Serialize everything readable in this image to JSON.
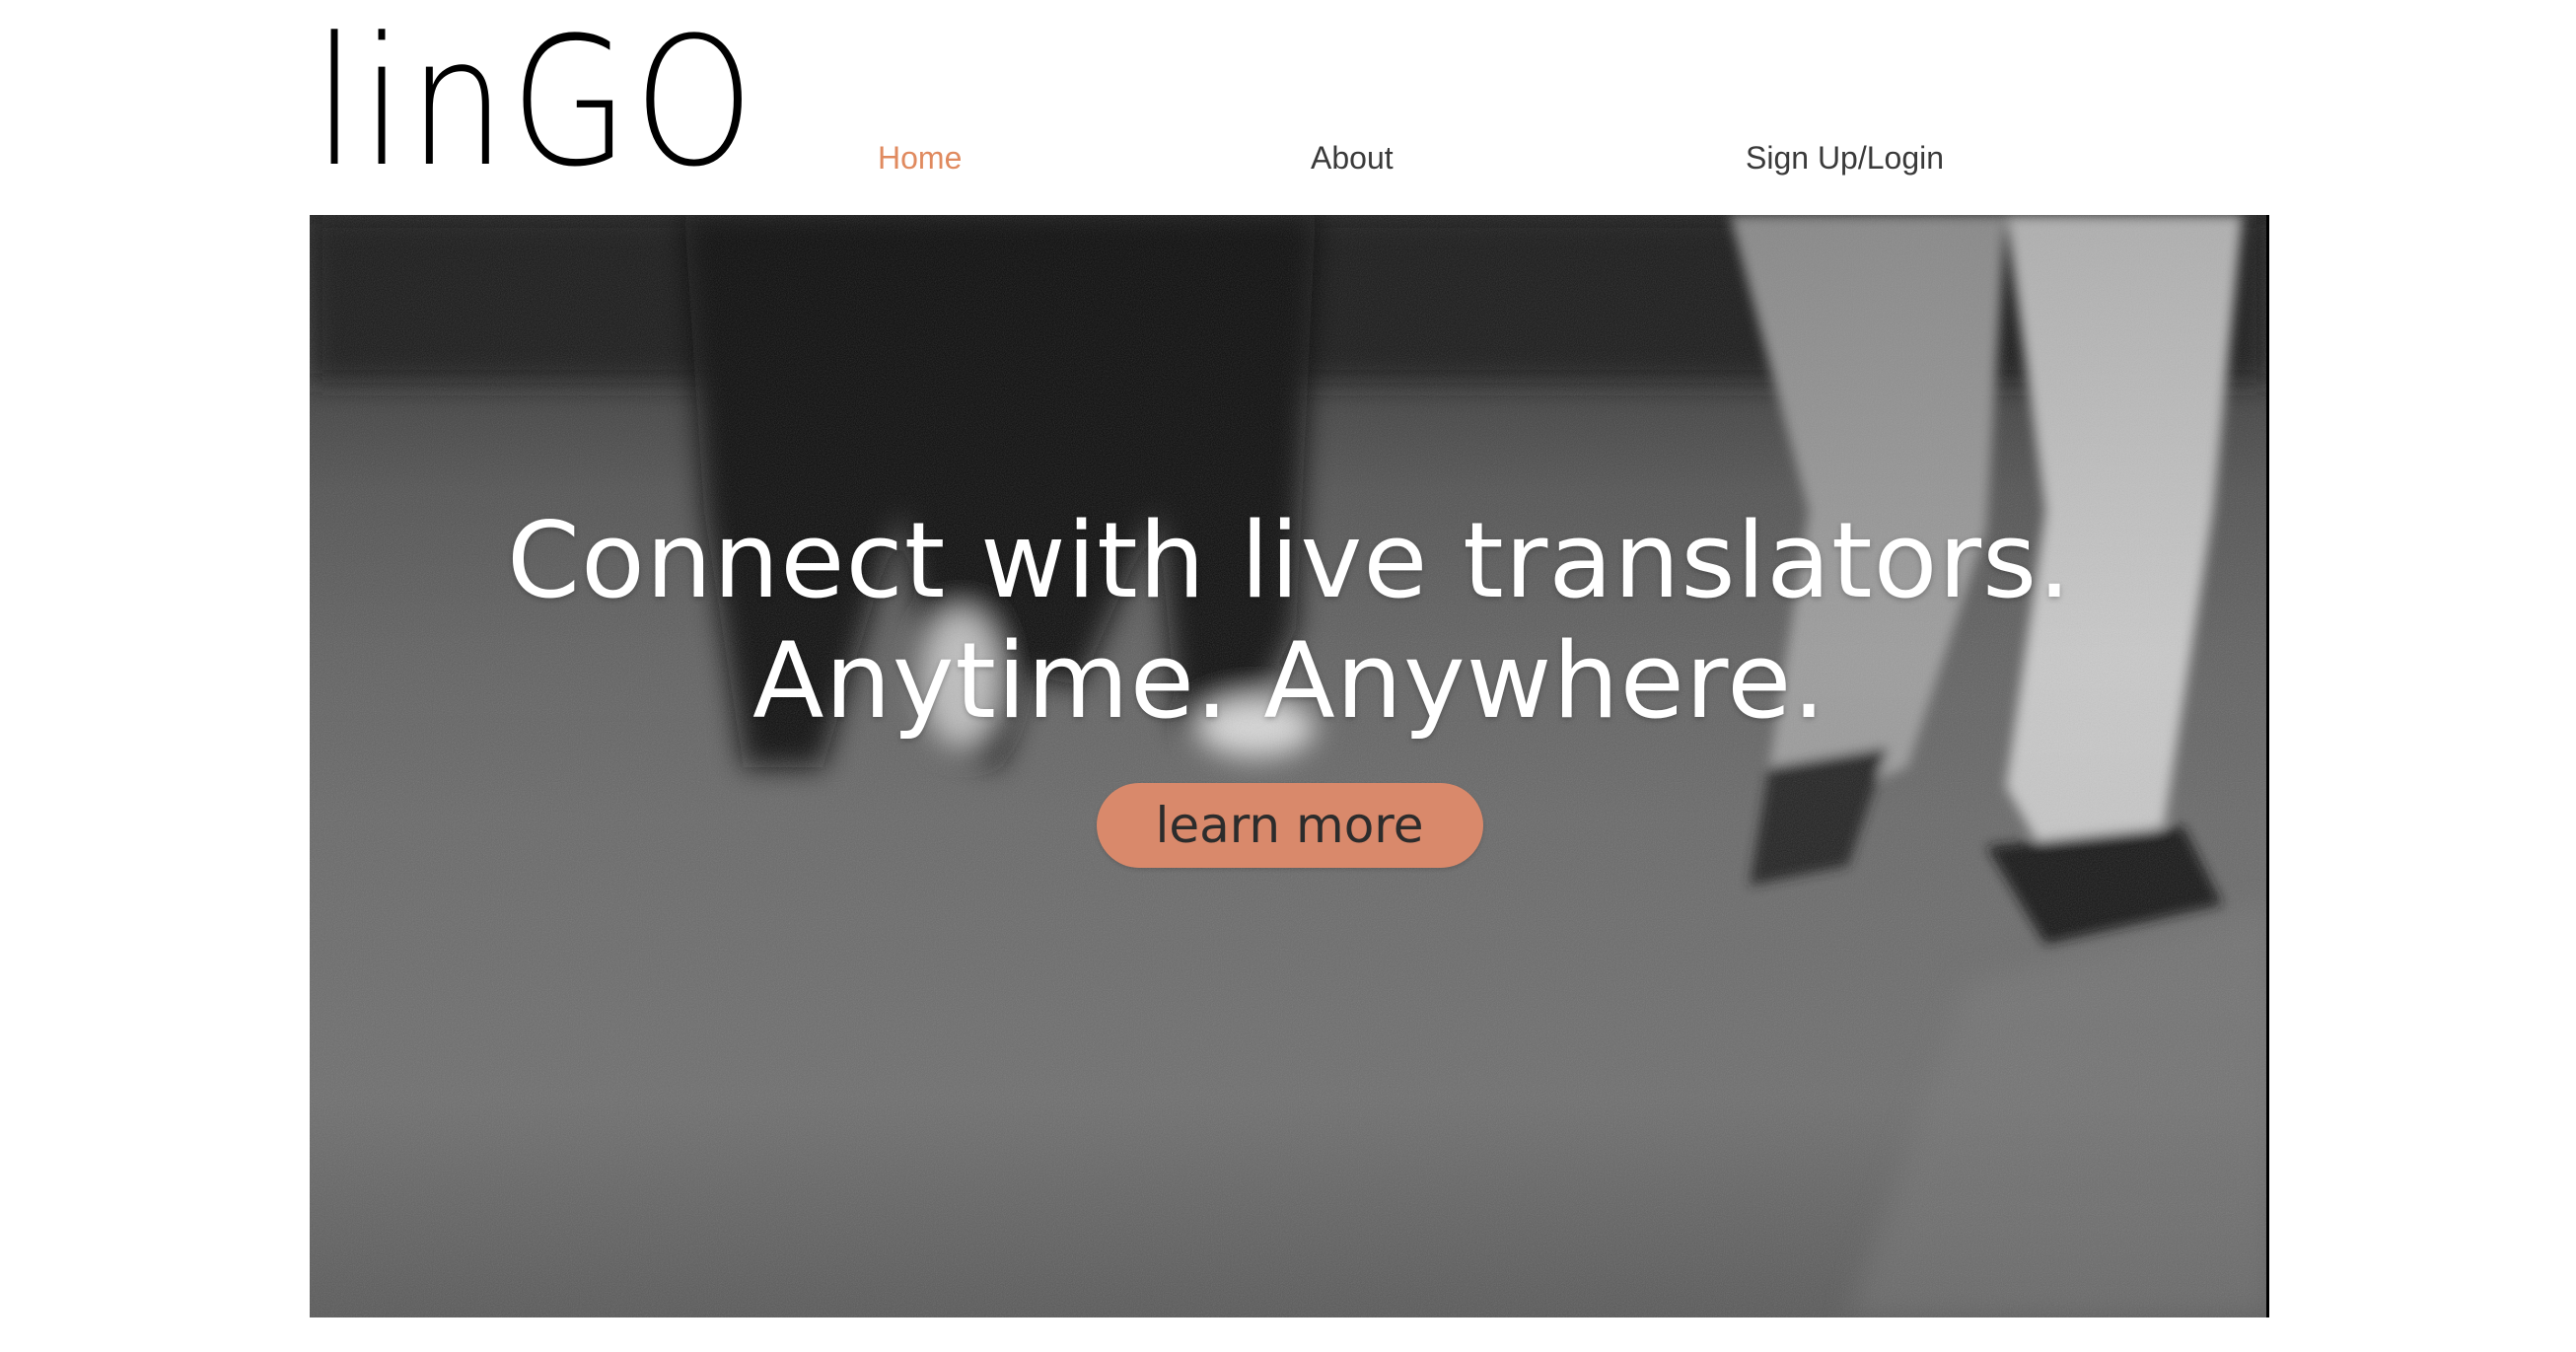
{
  "brand": {
    "logo_text": "linGO"
  },
  "nav": {
    "items": [
      {
        "label": "Home",
        "active": true
      },
      {
        "label": "About",
        "active": false
      },
      {
        "label": "Sign Up/Login",
        "active": false
      }
    ]
  },
  "hero": {
    "headline_line1": "Connect with live translators.",
    "headline_line2": "Anytime. Anywhere.",
    "cta_label": "learn more",
    "background_image": "black-and-white-walking-feet-photo"
  },
  "colors": {
    "accent": "#e08a5f",
    "cta_background": "#d9896b",
    "nav_text": "#3a3a3a",
    "headline_text": "#ffffff"
  }
}
